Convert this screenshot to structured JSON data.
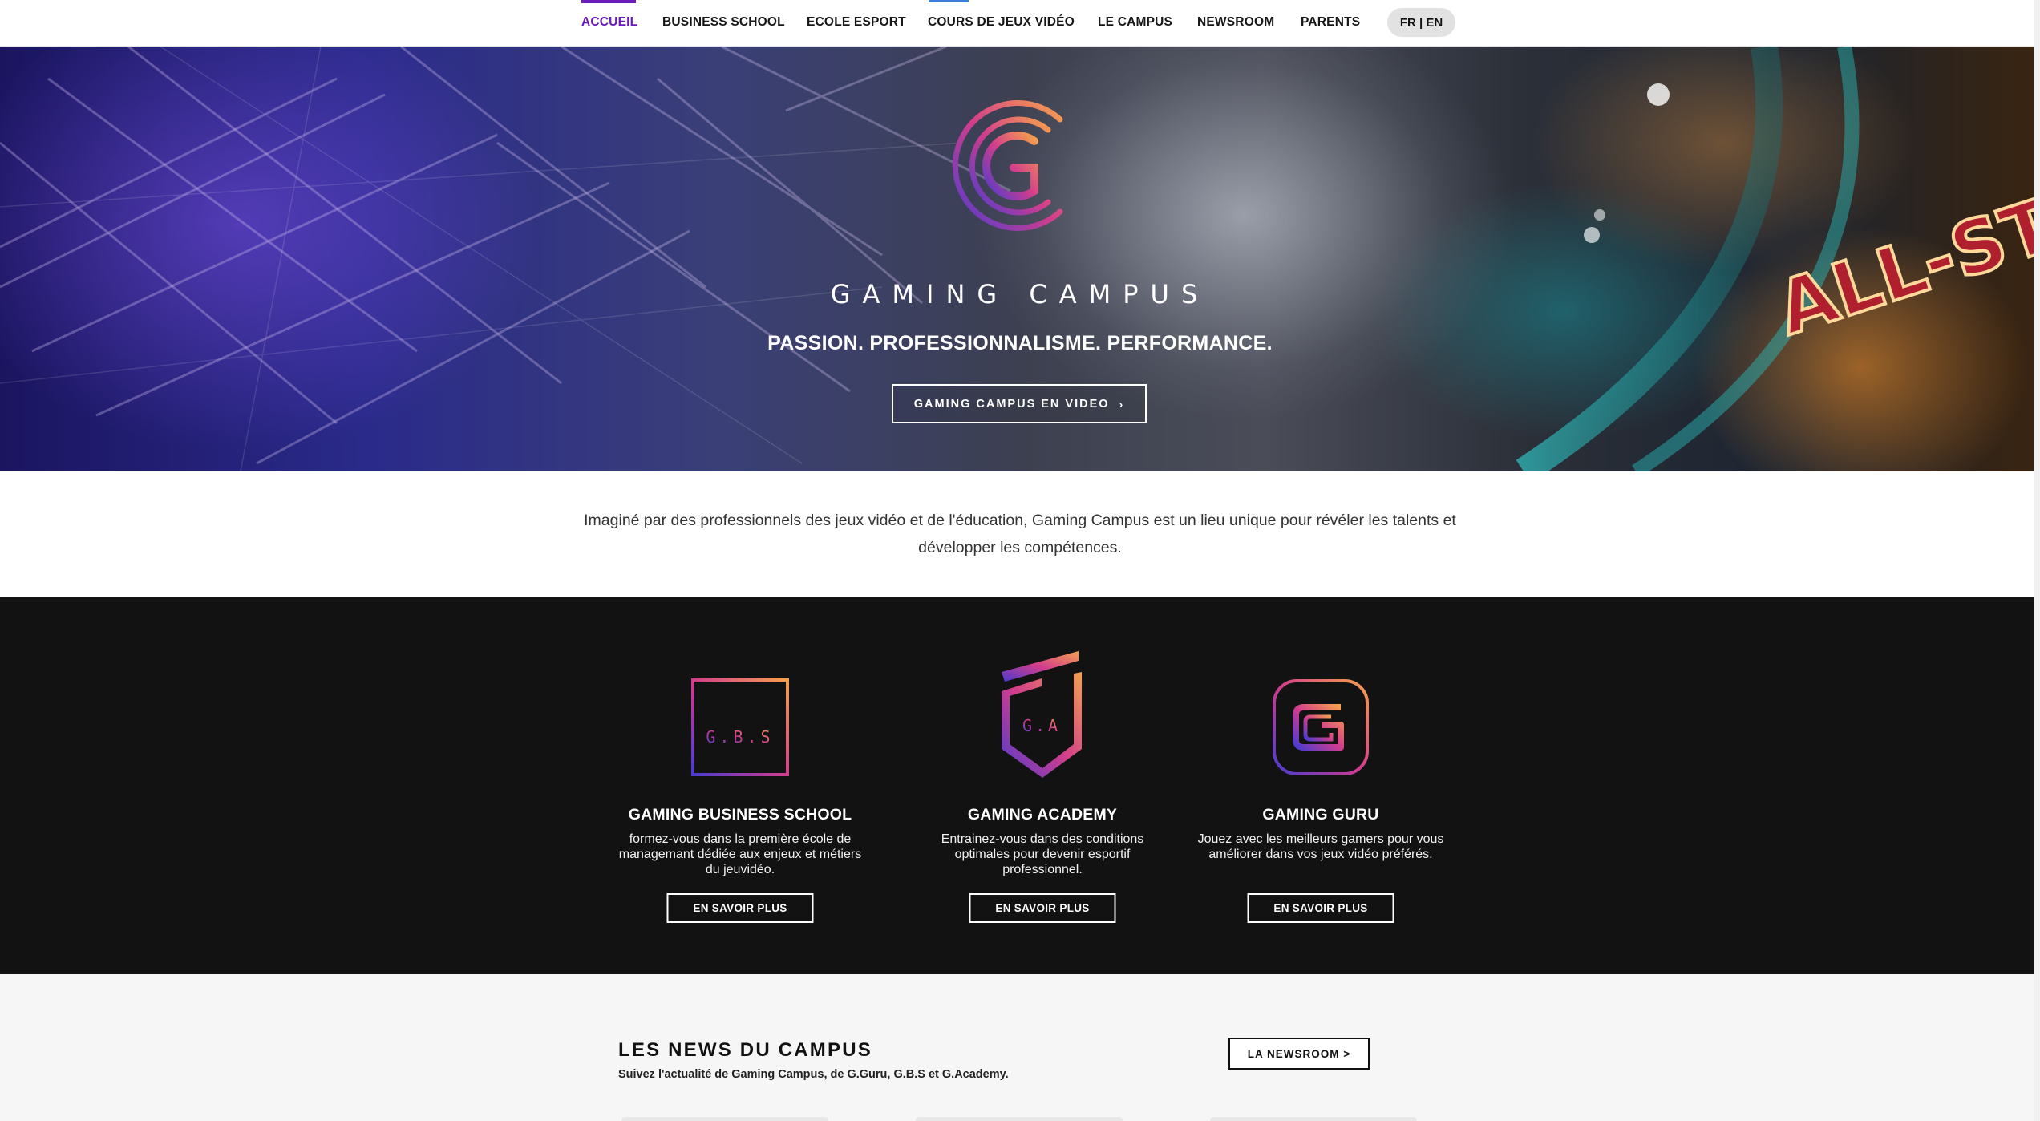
{
  "nav": {
    "items": [
      {
        "label": "ACCUEIL",
        "active": true
      },
      {
        "label": "BUSINESS SCHOOL",
        "active": false
      },
      {
        "label": "ECOLE ESPORT",
        "active": false
      },
      {
        "label": "COURS DE JEUX VIDÉO",
        "active": false
      },
      {
        "label": "LE CAMPUS",
        "active": false
      },
      {
        "label": "NEWSROOM",
        "active": false
      },
      {
        "label": "PARENTS",
        "active": false
      }
    ],
    "language": "FR | EN"
  },
  "hero": {
    "logo_icon": "gaming-campus-logo",
    "brand": "GAMING CAMPUS",
    "tagline": "PASSION. PROFESSIONNALISME. PERFORMANCE.",
    "video_button": "GAMING CAMPUS EN VIDEO",
    "video_button_icon": "chevron-right-icon",
    "background_text": "ALL-STAR"
  },
  "intro": {
    "text": "Imaginé par des professionnels des jeux vidéo et de l'éducation, Gaming Campus est un lieu unique pour révéler les talents et développer les compétences."
  },
  "schools": [
    {
      "logo_text": "G.B.S",
      "title": "GAMING BUSINESS SCHOOL",
      "description": "formez-vous dans la première école de managemant dédiée aux enjeux et métiers du jeuvidéo.",
      "button": "EN SAVOIR PLUS"
    },
    {
      "logo_text": "G.A",
      "title": "GAMING ACADEMY",
      "description": "Entrainez-vous dans des conditions optimales pour devenir esportif professionnel.",
      "button": "EN SAVOIR PLUS"
    },
    {
      "logo_text": "G",
      "title": "GAMING GURU",
      "description": "Jouez avec les meilleurs gamers pour vous améliorer dans vos jeux vidéo préférés.",
      "button": "EN SAVOIR PLUS"
    }
  ],
  "news": {
    "title": "LES NEWS DU CAMPUS",
    "subtitle": "Suivez l'actualité de Gaming Campus, de G.Guru, G.B.S et G.Academy.",
    "button": "LA NEWSROOM >"
  },
  "colors": {
    "accent": "#6a1bb8",
    "dark_section": "#121212",
    "gradient_start": "#f6a04d",
    "gradient_mid": "#d23d8c",
    "gradient_end": "#4a3bd0"
  }
}
